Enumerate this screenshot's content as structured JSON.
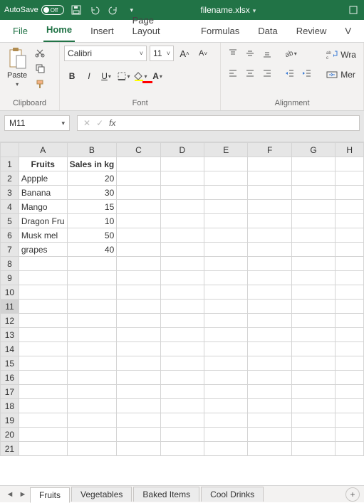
{
  "titlebar": {
    "autosave_label": "AutoSave",
    "autosave_state": "Off",
    "filename": "filename.xlsx"
  },
  "tabs": {
    "file": "File",
    "home": "Home",
    "insert": "Insert",
    "page_layout": "Page Layout",
    "formulas": "Formulas",
    "data": "Data",
    "review": "Review",
    "view_initial": "V"
  },
  "ribbon": {
    "clipboard": {
      "paste": "Paste",
      "title": "Clipboard"
    },
    "font": {
      "name": "Calibri",
      "size": "11",
      "bold": "B",
      "italic": "I",
      "underline": "U",
      "incA": "A",
      "decA": "A",
      "title": "Font"
    },
    "alignment": {
      "wrap": "Wra",
      "merge": "Mer",
      "title": "Alignment"
    }
  },
  "namebox": "M11",
  "fx_label": "fx",
  "columns": [
    "A",
    "B",
    "C",
    "D",
    "E",
    "F",
    "G",
    "H"
  ],
  "rows": [
    "1",
    "2",
    "3",
    "4",
    "5",
    "6",
    "7",
    "8",
    "9",
    "10",
    "11",
    "12",
    "13",
    "14",
    "15",
    "16",
    "17",
    "18",
    "19",
    "20",
    "21"
  ],
  "cells": {
    "A1": "Fruits",
    "B1": "Sales in kg",
    "A2": "Appple",
    "B2": "20",
    "A3": "Banana",
    "B3": "30",
    "A4": "Mango",
    "B4": "15",
    "A5": "Dragon Fru",
    "B5": "10",
    "A6": "Musk mel",
    "B6": "50",
    "A7": "grapes",
    "B7": "40"
  },
  "sheet_tabs": [
    "Fruits",
    "Vegetables",
    "Baked Items",
    "Cool Drinks"
  ],
  "chart_data": {
    "type": "table",
    "title": "Fruits — Sales in kg",
    "columns": [
      "Fruits",
      "Sales in kg"
    ],
    "rows": [
      [
        "Appple",
        20
      ],
      [
        "Banana",
        30
      ],
      [
        "Mango",
        15
      ],
      [
        "Dragon Fru",
        10
      ],
      [
        "Musk mel",
        50
      ],
      [
        "grapes",
        40
      ]
    ]
  }
}
